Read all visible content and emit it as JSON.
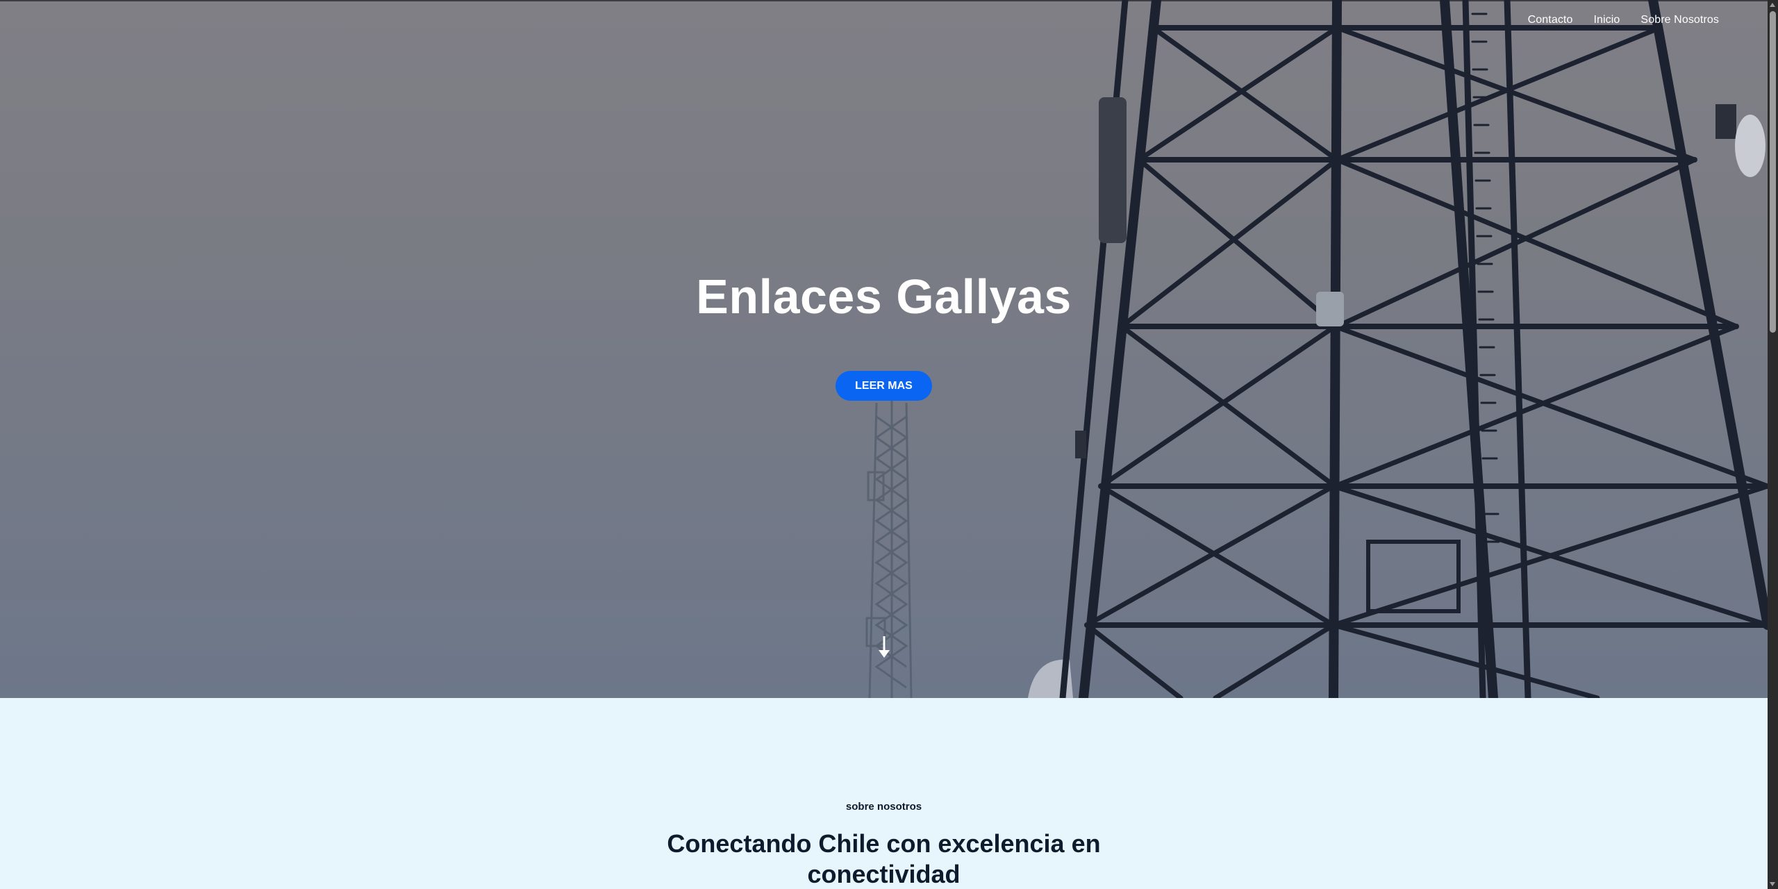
{
  "nav": {
    "items": [
      {
        "label": "Contacto"
      },
      {
        "label": "Inicio"
      },
      {
        "label": "Sobre Nosotros"
      }
    ]
  },
  "hero": {
    "title": "Enlaces Gallyas",
    "cta_label": "LEER MAS",
    "scroll_icon": "arrow-down-icon"
  },
  "about": {
    "eyebrow": "sobre nosotros",
    "heading": "Conectando Chile con excelencia en conectividad"
  },
  "colors": {
    "accent": "#0a65f2",
    "about_background": "#e7f5fd",
    "heading_text": "#0e1b2c"
  }
}
